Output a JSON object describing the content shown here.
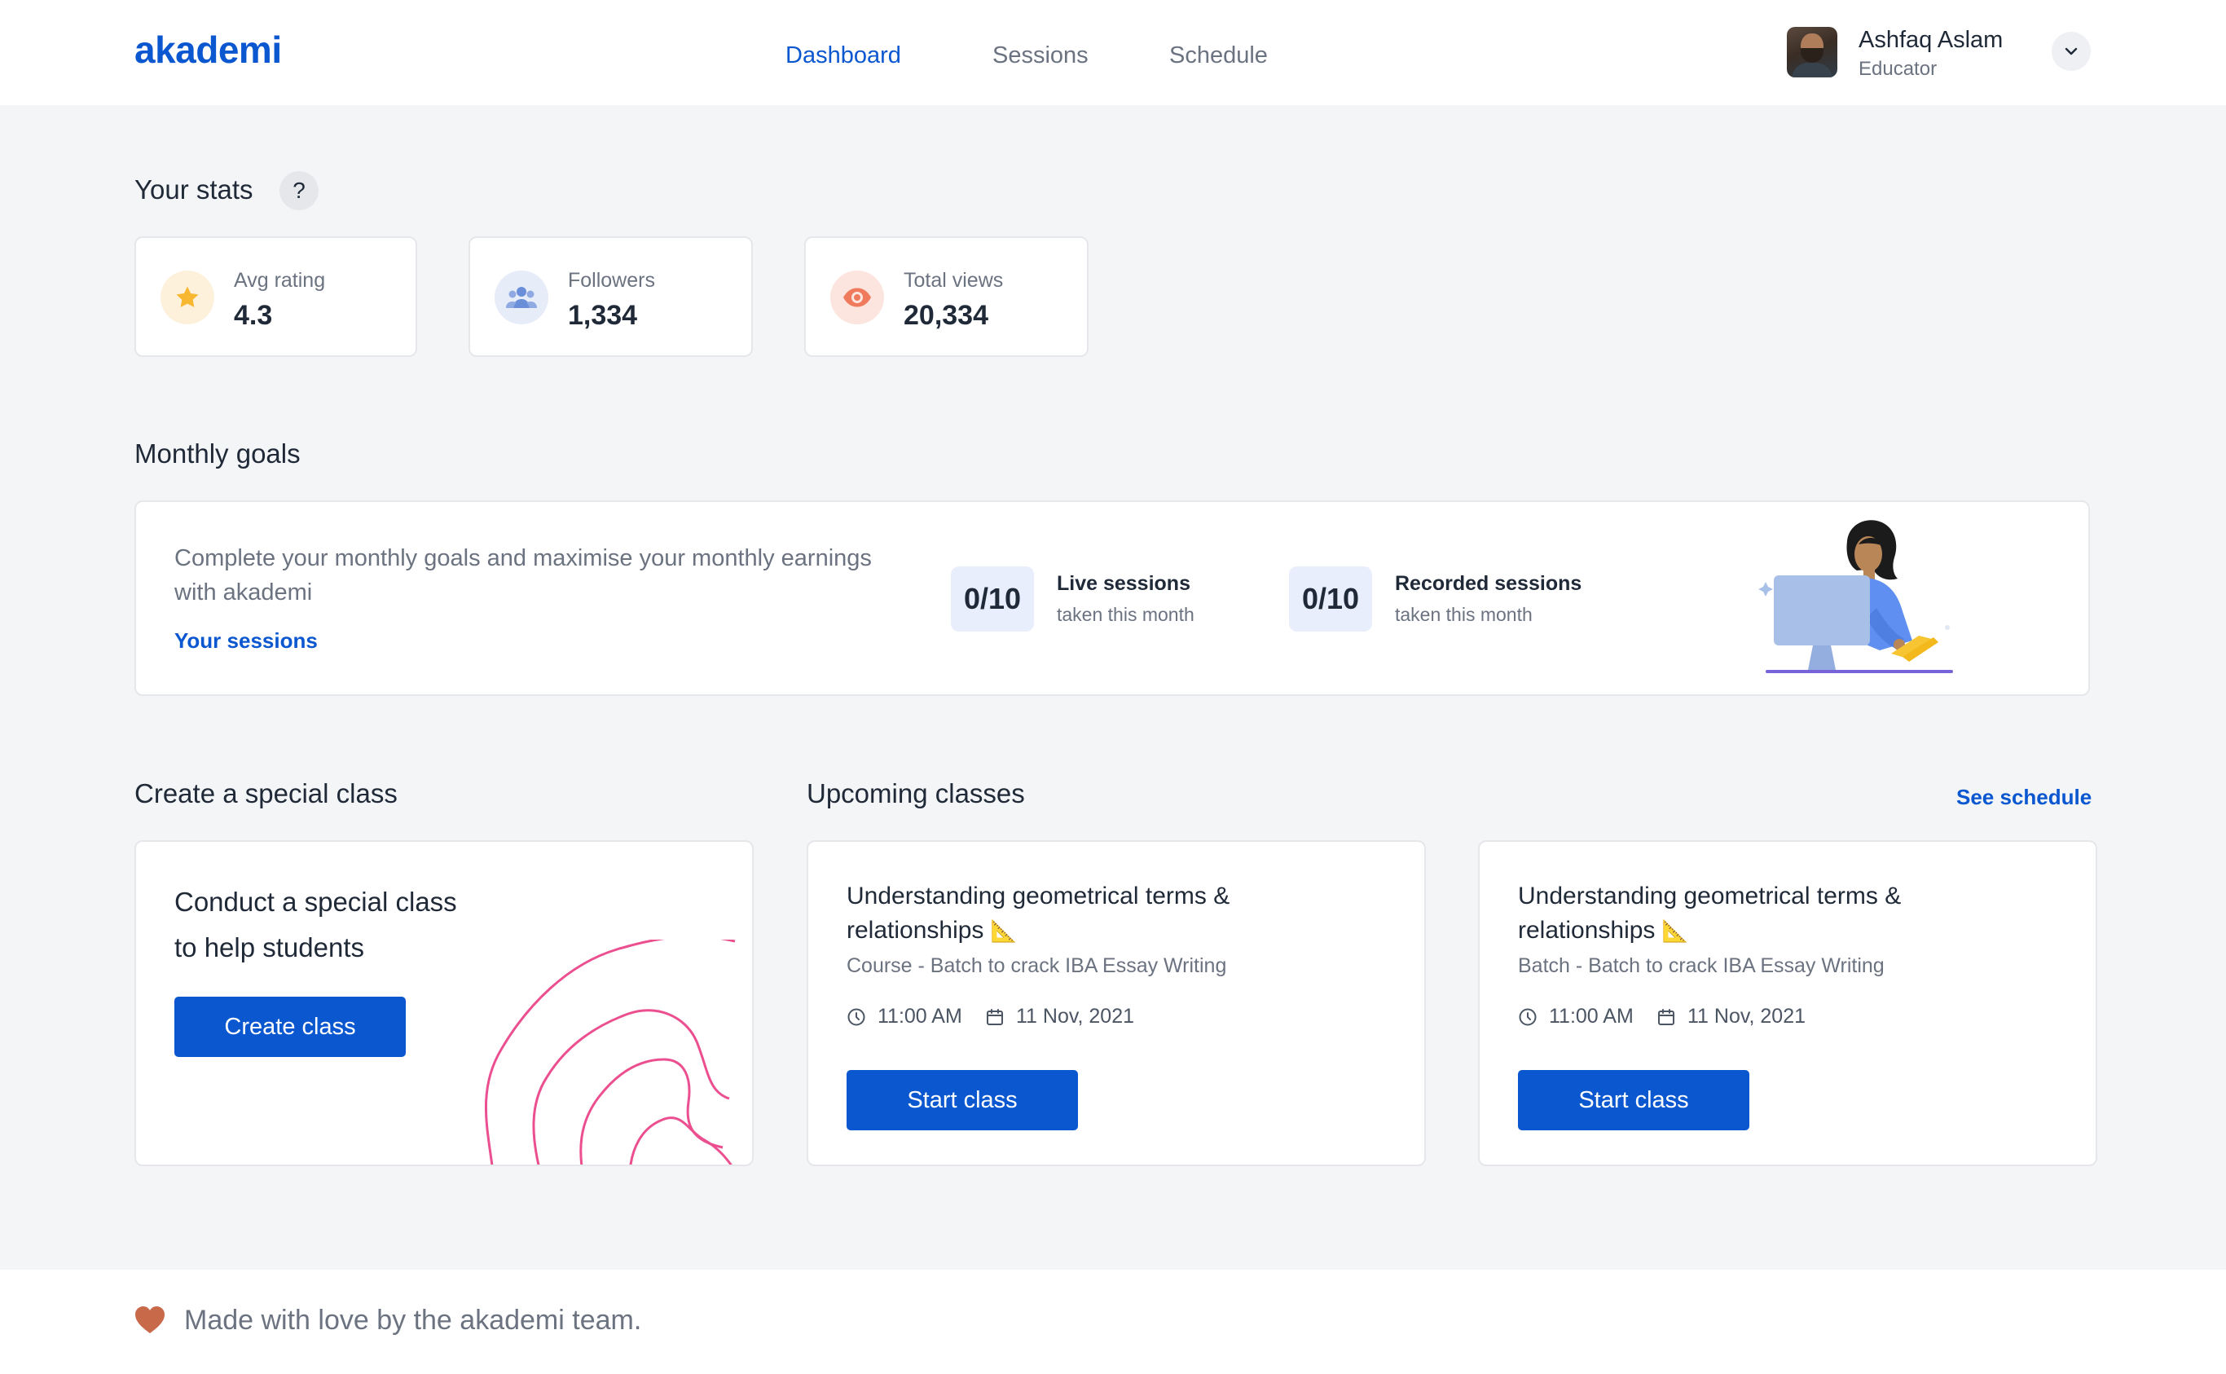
{
  "app": {
    "logo": "akademi"
  },
  "nav": {
    "items": [
      {
        "label": "Dashboard",
        "active": true
      },
      {
        "label": "Sessions",
        "active": false
      },
      {
        "label": "Schedule",
        "active": false
      }
    ]
  },
  "profile": {
    "name": "Ashfaq Aslam",
    "role": "Educator"
  },
  "stats": {
    "title": "Your stats",
    "help": "?",
    "items": [
      {
        "label": "Avg rating",
        "value": "4.3",
        "icon": "star-icon",
        "color": "#f7b731"
      },
      {
        "label": "Followers",
        "value": "1,334",
        "icon": "users-icon",
        "color": "#6a8fd8"
      },
      {
        "label": "Total views",
        "value": "20,334",
        "icon": "eye-icon",
        "color": "#f07a5c"
      }
    ]
  },
  "goals": {
    "title": "Monthly goals",
    "description": "Complete your monthly goals and maximise your monthly earnings with akademi",
    "link": "Your sessions",
    "items": [
      {
        "count": "0/10",
        "title": "Live sessions",
        "subtitle": "taken this month"
      },
      {
        "count": "0/10",
        "title": "Recorded sessions",
        "subtitle": "taken this month"
      }
    ]
  },
  "special": {
    "title": "Create a special class",
    "heading_line1": "Conduct a special class",
    "heading_line2": "to help students",
    "button": "Create class"
  },
  "upcoming": {
    "title": "Upcoming classes",
    "see_schedule": "See schedule",
    "classes": [
      {
        "title_line1": "Understanding geometrical terms &",
        "title_line2": "relationships",
        "emoji": "📐",
        "meta": "Course - Batch to crack IBA Essay Writing",
        "time": "11:00 AM",
        "date": "11 Nov, 2021",
        "button": "Start class"
      },
      {
        "title_line1": "Understanding geometrical terms &",
        "title_line2": "relationships",
        "emoji": "📐",
        "meta": "Batch - Batch to crack IBA Essay Writing",
        "time": "11:00 AM",
        "date": "11 Nov, 2021",
        "button": "Start class"
      }
    ]
  },
  "footer": {
    "text": "Made with love by the akademi team.",
    "icon": "heart-icon",
    "color": "#c8694a"
  },
  "colors": {
    "accent": "#0b57d0",
    "background": "#f4f5f7",
    "wave": "#ec4f8f"
  }
}
